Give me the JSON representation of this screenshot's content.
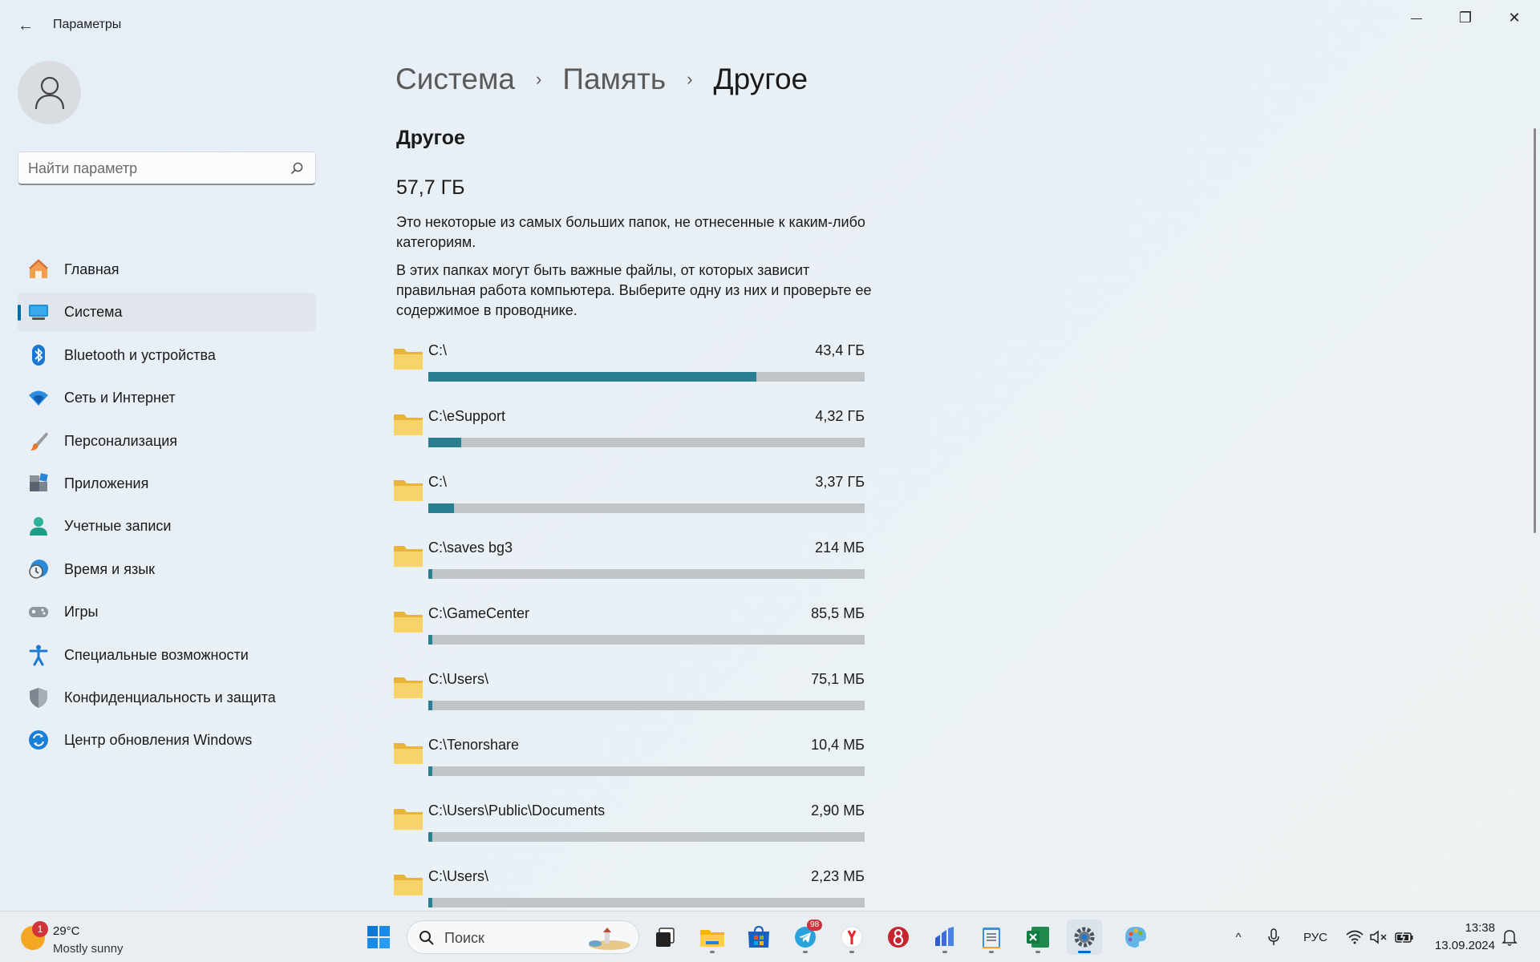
{
  "window": {
    "title": "Параметры",
    "back_glyph": "←",
    "minimize_glyph": "—",
    "maximize_glyph": "❐",
    "close_glyph": "✕"
  },
  "sidebar": {
    "search_placeholder": "Найти параметр",
    "items": [
      {
        "label": "Главная",
        "icon": "home-icon"
      },
      {
        "label": "Система",
        "icon": "system-icon",
        "active": true
      },
      {
        "label": "Bluetooth и устройства",
        "icon": "bluetooth-icon"
      },
      {
        "label": "Сеть и Интернет",
        "icon": "wifi-icon"
      },
      {
        "label": "Персонализация",
        "icon": "brush-icon"
      },
      {
        "label": "Приложения",
        "icon": "apps-icon"
      },
      {
        "label": "Учетные записи",
        "icon": "account-icon"
      },
      {
        "label": "Время и язык",
        "icon": "clock-globe-icon"
      },
      {
        "label": "Игры",
        "icon": "gamepad-icon"
      },
      {
        "label": "Специальные возможности",
        "icon": "accessibility-icon"
      },
      {
        "label": "Конфиденциальность и защита",
        "icon": "shield-icon"
      },
      {
        "label": "Центр обновления Windows",
        "icon": "update-icon"
      }
    ]
  },
  "breadcrumb": {
    "items": [
      "Система",
      "Память",
      "Другое"
    ],
    "separator": "›"
  },
  "content": {
    "title": "Другое",
    "total": "57,7 ГБ",
    "description_1": "Это некоторые из самых больших папок, не отнесенные к каким-либо категориям.",
    "description_2": "В этих папках могут быть важные файлы, от которых зависит правильная работа компьютера. Выберите одну из них и проверьте ее содержимое в проводнике.",
    "folders": [
      {
        "path": "C:\\",
        "size": "43,4 ГБ",
        "fraction": 0.752
      },
      {
        "path": "C:\\eSupport",
        "size": "4,32 ГБ",
        "fraction": 0.075
      },
      {
        "path": "C:\\",
        "size": "3,37 ГБ",
        "fraction": 0.058
      },
      {
        "path": "C:\\saves bg3",
        "size": "214 МБ",
        "fraction": 0.009
      },
      {
        "path": "C:\\GameCenter",
        "size": "85,5 МБ",
        "fraction": 0.009
      },
      {
        "path": "C:\\Users\\",
        "size": "75,1 МБ",
        "fraction": 0.009
      },
      {
        "path": "C:\\Tenorshare",
        "size": "10,4 МБ",
        "fraction": 0.009
      },
      {
        "path": "C:\\Users\\Public\\Documents",
        "size": "2,90 МБ",
        "fraction": 0.009
      },
      {
        "path": "C:\\Users\\",
        "size": "2,23 МБ",
        "fraction": 0.009
      }
    ]
  },
  "taskbar": {
    "weather_temp": "29°C",
    "weather_condition": "Mostly sunny",
    "weather_badge": "1",
    "search_label": "Поиск",
    "telegram_badge": "98",
    "language": "РУС",
    "time": "13:38",
    "date": "13.09.2024",
    "tray_chevron": "^"
  },
  "colors": {
    "accent": "#006ea0",
    "bar_fill": "#2a7f90",
    "bar_track": "#bfc4c8"
  }
}
